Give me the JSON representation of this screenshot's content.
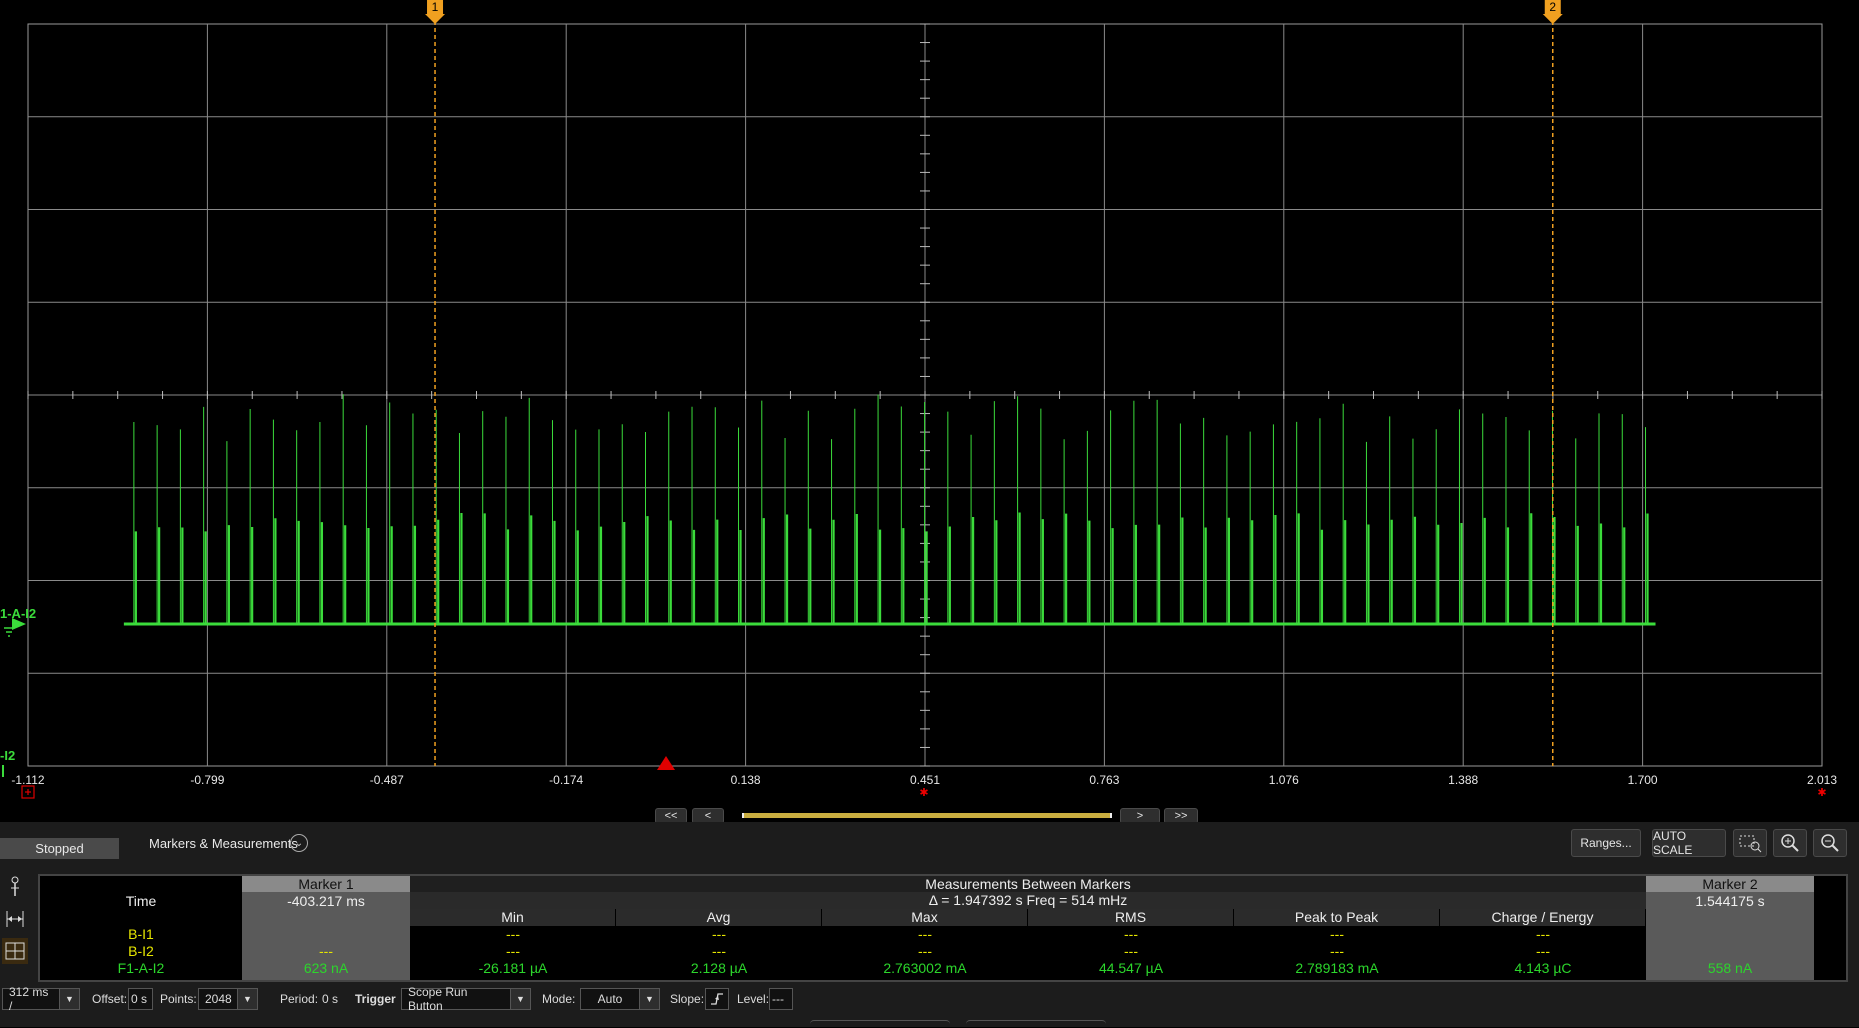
{
  "chart_data": {
    "type": "line",
    "trace_name": "F1-A-I2",
    "trace_color": "#3bdc3b",
    "x_tick_labels": [
      "-1.112",
      "-0.799",
      "-0.487",
      "-0.174",
      "0.138",
      "0.451",
      "0.763",
      "1.076",
      "1.388",
      "1.700",
      "2.013"
    ],
    "x_range": [
      -1.112,
      2.013
    ],
    "marker1_x": -0.403,
    "marker2_x": 1.544,
    "marker1_label": "1",
    "marker2_label": "2",
    "trace_start_x": -0.945,
    "trace_end_x": 1.723,
    "pulse_count": 66,
    "baseline_level": 0.0,
    "pulse_levels": {
      "high": [
        0.55,
        0.7
      ],
      "mid": [
        0.28,
        0.34
      ]
    },
    "grid": true,
    "trigger_x": -0.31
  },
  "left_labels": {
    "channel_label_1": "1-A-I2",
    "channel_label_2": "-I2"
  },
  "nav": {
    "first": "<<",
    "prev": "<",
    "next": ">",
    "last": ">>"
  },
  "status": {
    "state": "Stopped"
  },
  "section_title": "Markers & Measurements",
  "toolbar": {
    "ranges": "Ranges...",
    "autoscale": "AUTO SCALE"
  },
  "table": {
    "time_label": "Time",
    "marker1": {
      "title": "Marker 1",
      "time": "-403.217 ms"
    },
    "marker2": {
      "title": "Marker 2",
      "time": "1.544175 s"
    },
    "between_title": "Measurements Between Markers",
    "delta": "Δ = 1.947392 s   Freq = 514 mHz",
    "columns": [
      "Min",
      "Avg",
      "Max",
      "RMS",
      "Peak to Peak",
      "Charge / Energy"
    ],
    "rows": [
      {
        "name": "B-I1",
        "color": "#e6e600",
        "m1": "",
        "values": [
          "---",
          "---",
          "---",
          "---",
          "---",
          "---"
        ],
        "m2": ""
      },
      {
        "name": "B-I2",
        "color": "#e6e600",
        "m1": "---",
        "values": [
          "---",
          "---",
          "---",
          "---",
          "---",
          "---"
        ],
        "m2": ""
      },
      {
        "name": "F1-A-I2",
        "color": "#2cd62c",
        "m1": "623 nA",
        "values": [
          "-26.181 µA",
          "2.128 µA",
          "2.763002 mA",
          "44.547 µA",
          "2.789183 mA",
          "4.143 µC"
        ],
        "m2": "558 nA"
      }
    ]
  },
  "bottom": {
    "timebase": "312 ms /",
    "offset_label": "Offset:",
    "offset_value": "0 s",
    "points_label": "Points:",
    "points_value": "2048",
    "period_label": "Period:",
    "period_value": "0 s",
    "trigger_label": "Trigger",
    "trigger_value": "Scope Run Button",
    "mode_label": "Mode:",
    "mode_value": "Auto",
    "slope_label": "Slope:",
    "level_label": "Level:",
    "level_value": "---"
  }
}
